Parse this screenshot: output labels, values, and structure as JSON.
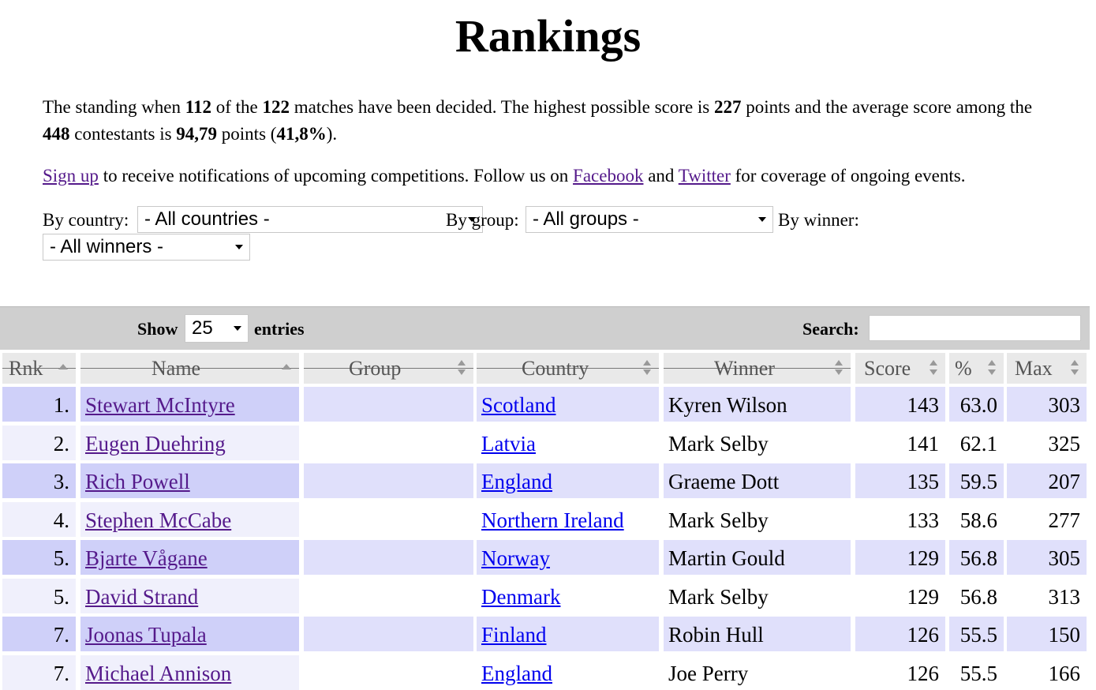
{
  "page_title": "Rankings",
  "intro": {
    "p1": "The standing when ",
    "decided": "112",
    "p2": " of the ",
    "total": "122",
    "p3": " matches have been decided. The highest possible score is ",
    "max_score": "227",
    "p4": " points and the average score among the ",
    "contestants": "448",
    "p5": " contestants is ",
    "avg": "94,79",
    "p6": " points (",
    "pct": "41,8%",
    "p7": ")."
  },
  "signup": {
    "signup_link": "Sign up",
    "t1": " to receive notifications of upcoming competitions. Follow us on ",
    "facebook": "Facebook",
    "t2": " and ",
    "twitter": "Twitter",
    "t3": " for coverage of ongoing events."
  },
  "filters": {
    "country_label": "By country:",
    "country_value": "- All countries -",
    "group_label": "By group:",
    "group_value": "- All groups -",
    "winner_label": "By winner:",
    "winner_value": "- All winners -"
  },
  "toolbar": {
    "show_label": "Show",
    "length_value": "25",
    "entries_label": "entries",
    "search_label": "Search:",
    "search_value": ""
  },
  "columns": [
    "Rnk",
    "Name",
    "Group",
    "Country",
    "Winner",
    "Score",
    "%",
    "Max"
  ],
  "colors": {
    "row_odd": "#e0e0fb",
    "row_odd_sorted": "#cfd0f9",
    "row_even": "#ffffff",
    "row_even_sorted": "#f0f0fc",
    "link_visited": "#551a8b",
    "link": "#0000ee"
  },
  "rows": [
    {
      "rank": "1.",
      "name": "Stewart McIntyre",
      "group": "",
      "country": "Scotland",
      "winner": "Kyren Wilson",
      "score": "143",
      "pct": "63.0",
      "max": "303"
    },
    {
      "rank": "2.",
      "name": "Eugen Duehring",
      "group": "",
      "country": "Latvia",
      "winner": "Mark Selby",
      "score": "141",
      "pct": "62.1",
      "max": "325"
    },
    {
      "rank": "3.",
      "name": "Rich Powell",
      "group": "",
      "country": "England",
      "winner": "Graeme Dott",
      "score": "135",
      "pct": "59.5",
      "max": "207"
    },
    {
      "rank": "4.",
      "name": "Stephen McCabe",
      "group": "",
      "country": "Northern Ireland",
      "winner": "Mark Selby",
      "score": "133",
      "pct": "58.6",
      "max": "277"
    },
    {
      "rank": "5.",
      "name": "Bjarte Vågane",
      "group": "",
      "country": "Norway",
      "winner": "Martin Gould",
      "score": "129",
      "pct": "56.8",
      "max": "305"
    },
    {
      "rank": "5.",
      "name": "David Strand",
      "group": "",
      "country": "Denmark",
      "winner": "Mark Selby",
      "score": "129",
      "pct": "56.8",
      "max": "313"
    },
    {
      "rank": "7.",
      "name": "Joonas Tupala",
      "group": "",
      "country": "Finland",
      "winner": "Robin Hull",
      "score": "126",
      "pct": "55.5",
      "max": "150"
    },
    {
      "rank": "7.",
      "name": "Michael Annison",
      "group": "",
      "country": "England",
      "winner": "Joe Perry",
      "score": "126",
      "pct": "55.5",
      "max": "166"
    }
  ]
}
